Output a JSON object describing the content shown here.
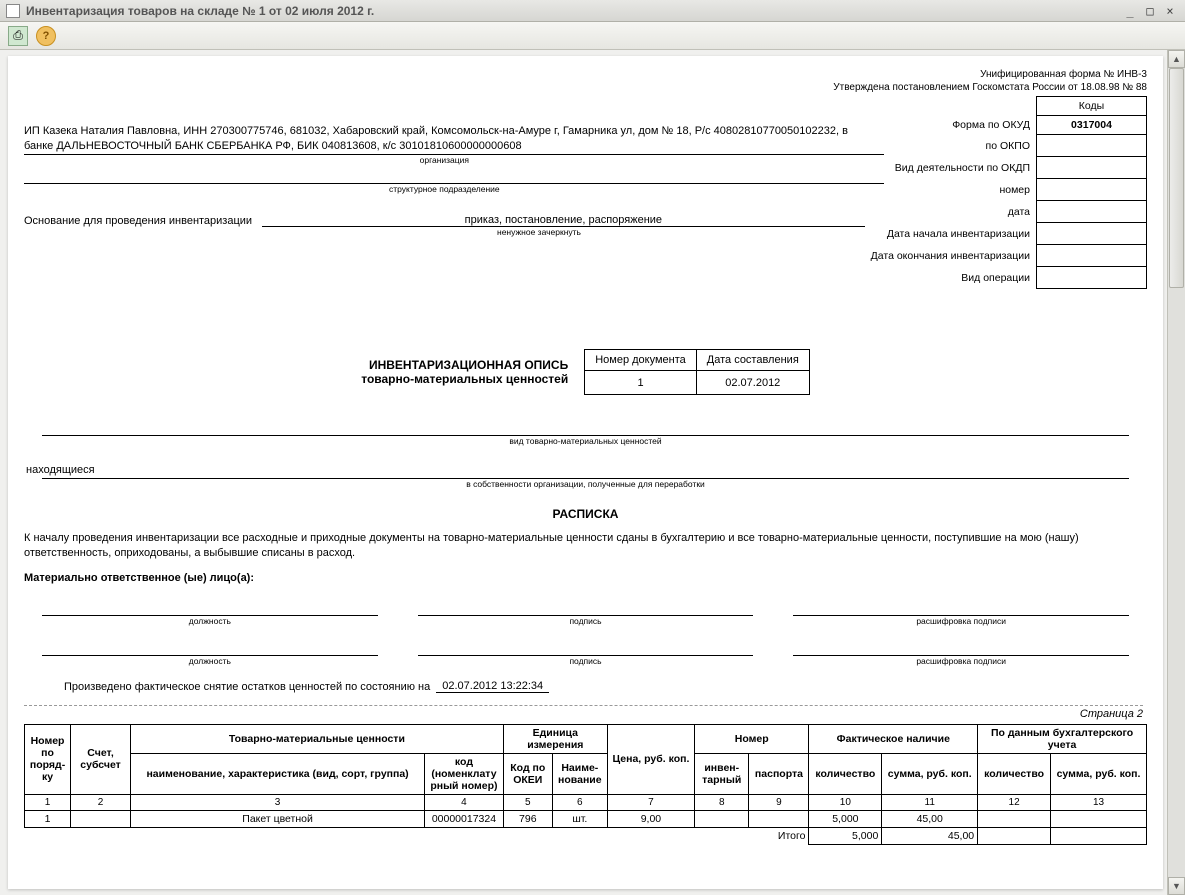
{
  "window": {
    "title": "Инвентаризация товаров на складе № 1 от 02 июля 2012 г."
  },
  "header": {
    "form_line": "Унифицированная форма № ИНВ-3",
    "approved_line": "Утверждена постановлением Госкомстата России от 18.08.98 № 88"
  },
  "codes": {
    "codes_hdr": "Коды",
    "okud_label": "Форма по ОКУД",
    "okud": "0317004",
    "okpo_label": "по ОКПО",
    "okpo": "",
    "okdp_label": "Вид деятельности по ОКДП",
    "okdp": "",
    "number_label": "номер",
    "number": "",
    "date_label": "дата",
    "date": "",
    "start_label": "Дата начала инвентаризации",
    "start": "",
    "end_label": "Дата окончания инвентаризации",
    "end": "",
    "oper_label": "Вид операции",
    "oper": ""
  },
  "org": {
    "text": "ИП Казека Наталия Павловна, ИНН 270300775746, 681032, Хабаровский край, Комсомольск-на-Амуре г, Гамарника ул, дом № 18, Р/с 40802810770050102232, в банке ДАЛЬНЕВОСТОЧНЫЙ БАНК СБЕРБАНКА РФ, БИК 040813608, к/с 30101810600000000608",
    "org_caption": "организация",
    "subdiv_caption": "структурное подразделение"
  },
  "basis": {
    "label": "Основание для проведения инвентаризации",
    "value": "приказ, постановление, распоряжение",
    "caption": "ненужное зачеркнуть"
  },
  "title": {
    "line1": "ИНВЕНТАРИЗАЦИОННАЯ ОПИСЬ",
    "line2": "товарно-материальных ценностей",
    "docnum_hdr": "Номер документа",
    "docdate_hdr": "Дата составления",
    "docnum": "1",
    "docdate": "02.07.2012"
  },
  "sections": {
    "kind_caption": "вид товарно-материальных ценностей",
    "located_label": "находящиеся",
    "ownership_caption": "в собственности организации, полученные для переработки"
  },
  "raspiska": {
    "title": "РАСПИСКА",
    "para": "К началу проведения инвентаризации все расходные и приходные документы на товарно-материальные ценности сданы в бухгалтерию и все товарно-материальные ценности, поступившие на мою (нашу) ответственность, оприходованы, а выбывшие списаны в расход.",
    "resp_label": "Материально ответственное (ые) лицо(а):",
    "pos_caption": "должность",
    "sign_caption": "подпись",
    "decr_caption": "расшифровка подписи",
    "state_label": "Произведено фактическое снятие остатков ценностей по состоянию на",
    "state_value": "02.07.2012 13:22:34"
  },
  "page2": {
    "label": "Страница 2"
  },
  "table": {
    "headers": {
      "num": "Номер по поряд-ку",
      "account": "Счет, субсчет",
      "tmc": "Товарно-материальные ценности",
      "name": "наименование, характеристика (вид, сорт, группа)",
      "code": "код (номенклату рный номер)",
      "unit": "Единица измерения",
      "okei": "Код по ОКЕИ",
      "unitname": "Наиме-нование",
      "price": "Цена, руб. коп.",
      "number_grp": "Номер",
      "inv": "инвен-тарный",
      "passport": "паспорта",
      "fact": "Фактическое наличие",
      "book": "По данным бухгалтерского учета",
      "qty": "количество",
      "sum": "сумма, руб. коп."
    },
    "colnums": [
      "1",
      "2",
      "3",
      "4",
      "5",
      "6",
      "7",
      "8",
      "9",
      "10",
      "11",
      "12",
      "13"
    ],
    "rows": [
      {
        "n": "1",
        "acc": "",
        "name": "Пакет цветной",
        "code": "00000017324",
        "okei": "796",
        "unit": "шт.",
        "price": "9,00",
        "inv": "",
        "pass": "",
        "fqty": "5,000",
        "fsum": "45,00",
        "bqty": "",
        "bsum": ""
      }
    ],
    "total_label": "Итого",
    "total_qty": "5,000",
    "total_sum": "45,00"
  }
}
